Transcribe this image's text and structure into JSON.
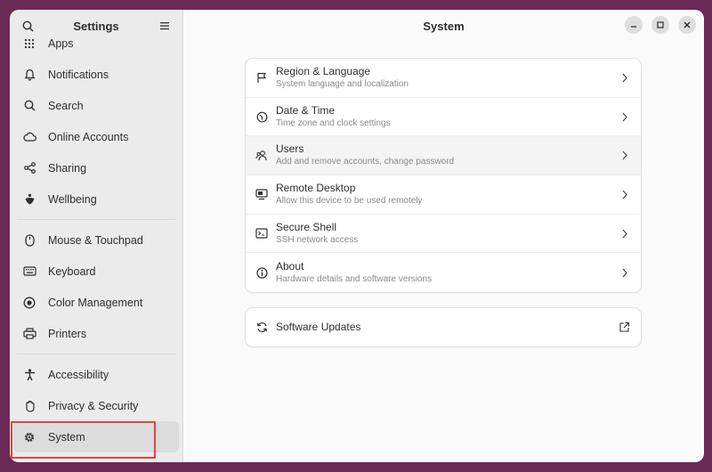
{
  "sidebar": {
    "title": "Settings",
    "groups": [
      [
        {
          "label": "Apps",
          "icon": "apps-grid-icon"
        },
        {
          "label": "Notifications",
          "icon": "bell-icon"
        },
        {
          "label": "Search",
          "icon": "search-icon"
        },
        {
          "label": "Online Accounts",
          "icon": "cloud-icon"
        },
        {
          "label": "Sharing",
          "icon": "share-icon"
        },
        {
          "label": "Wellbeing",
          "icon": "wellbeing-icon"
        }
      ],
      [
        {
          "label": "Mouse & Touchpad",
          "icon": "mouse-icon"
        },
        {
          "label": "Keyboard",
          "icon": "keyboard-icon"
        },
        {
          "label": "Color Management",
          "icon": "color-palette-icon"
        },
        {
          "label": "Printers",
          "icon": "printer-icon"
        }
      ],
      [
        {
          "label": "Accessibility",
          "icon": "accessibility-icon"
        },
        {
          "label": "Privacy & Security",
          "icon": "hand-icon"
        },
        {
          "label": "System",
          "icon": "gear-icon",
          "active": true
        }
      ]
    ]
  },
  "main": {
    "title": "System",
    "rows": [
      {
        "title": "Region & Language",
        "subtitle": "System language and localization",
        "icon": "flag-icon"
      },
      {
        "title": "Date & Time",
        "subtitle": "Time zone and clock settings",
        "icon": "clock-icon"
      },
      {
        "title": "Users",
        "subtitle": "Add and remove accounts, change password",
        "icon": "users-icon"
      },
      {
        "title": "Remote Desktop",
        "subtitle": "Allow this device to be used remotely",
        "icon": "remote-desktop-icon"
      },
      {
        "title": "Secure Shell",
        "subtitle": "SSH network access",
        "icon": "terminal-icon"
      },
      {
        "title": "About",
        "subtitle": "Hardware details and software versions",
        "icon": "info-icon"
      }
    ],
    "updates": {
      "title": "Software Updates",
      "icon": "refresh-icon",
      "trailing_icon": "external-link-icon"
    }
  },
  "colors": {
    "accent_highlight": "#e0453f",
    "window_bg": "#fafafa",
    "sidebar_bg": "#ebebeb",
    "desktop_bg": "#6b2a55"
  }
}
